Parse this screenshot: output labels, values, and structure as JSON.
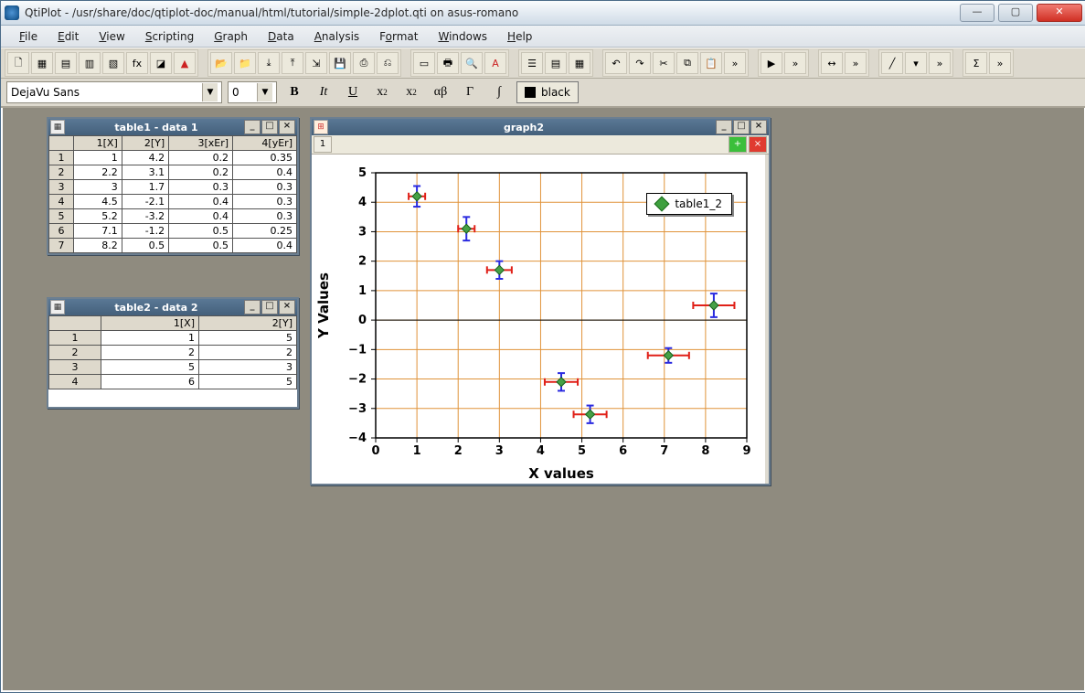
{
  "window": {
    "title": "QtiPlot - /usr/share/doc/qtiplot-doc/manual/html/tutorial/simple-2dplot.qti on asus-romano"
  },
  "menu": [
    "File",
    "Edit",
    "View",
    "Scripting",
    "Graph",
    "Data",
    "Analysis",
    "Format",
    "Windows",
    "Help"
  ],
  "format_toolbar": {
    "font_name": "DejaVu Sans",
    "font_size": "0",
    "bold": "B",
    "italic": "It",
    "underline": "U",
    "sup": "x²",
    "sub": "x₂",
    "greek1": "αβ",
    "greek2": "Γ",
    "integral": "∫",
    "color_label": "black"
  },
  "table1": {
    "title": "table1 - data 1",
    "headers": [
      "1[X]",
      "2[Y]",
      "3[xEr]",
      "4[yEr]"
    ],
    "rows": [
      [
        "1",
        "1",
        "4.2",
        "0.2",
        "0.35"
      ],
      [
        "2",
        "2.2",
        "3.1",
        "0.2",
        "0.4"
      ],
      [
        "3",
        "3",
        "1.7",
        "0.3",
        "0.3"
      ],
      [
        "4",
        "4.5",
        "-2.1",
        "0.4",
        "0.3"
      ],
      [
        "5",
        "5.2",
        "-3.2",
        "0.4",
        "0.3"
      ],
      [
        "6",
        "7.1",
        "-1.2",
        "0.5",
        "0.25"
      ],
      [
        "7",
        "8.2",
        "0.5",
        "0.5",
        "0.4"
      ]
    ]
  },
  "table2": {
    "title": "table2 - data 2",
    "headers": [
      "1[X]",
      "2[Y]"
    ],
    "rows": [
      [
        "1",
        "1",
        "5"
      ],
      [
        "2",
        "2",
        "2"
      ],
      [
        "3",
        "5",
        "3"
      ],
      [
        "4",
        "6",
        "5"
      ]
    ]
  },
  "graph": {
    "title": "graph2",
    "layer_label": "1",
    "legend_label": "table1_2",
    "xlabel": "X values",
    "ylabel": "Y Values"
  },
  "chart_data": {
    "type": "scatter",
    "title": "",
    "xlabel": "X values",
    "ylabel": "Y Values",
    "xlim": [
      0,
      9
    ],
    "ylim": [
      -4,
      5
    ],
    "xticks": [
      0,
      1,
      2,
      3,
      4,
      5,
      6,
      7,
      8,
      9
    ],
    "yticks": [
      -4,
      -3,
      -2,
      -1,
      0,
      1,
      2,
      3,
      4,
      5
    ],
    "series": [
      {
        "name": "table1_2",
        "x": [
          1,
          2.2,
          3,
          4.5,
          5.2,
          7.1,
          8.2
        ],
        "y": [
          4.2,
          3.1,
          1.7,
          -2.1,
          -3.2,
          -1.2,
          0.5
        ],
        "xerr": [
          0.2,
          0.2,
          0.3,
          0.4,
          0.4,
          0.5,
          0.5
        ],
        "yerr": [
          0.35,
          0.4,
          0.3,
          0.3,
          0.3,
          0.25,
          0.4
        ]
      }
    ]
  }
}
